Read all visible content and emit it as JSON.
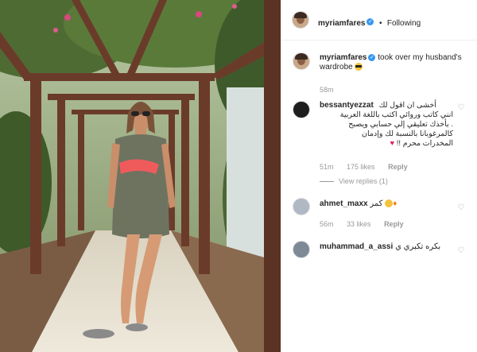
{
  "post": {
    "author": "myriamfares",
    "follow_status": "Following",
    "dot": "•"
  },
  "caption": {
    "username": "myriamfares",
    "text": "took over my husband's wardrobe",
    "emoji": "sunglasses-emoji",
    "time": "58m"
  },
  "comments": [
    {
      "username": "bessantyezzat",
      "lines": [
        "أخشى ان اقول لك",
        "انني كاتب وروائي اكتب باللغة العربية",
        ". بأخذك تعليقي إلي حسابي ويصبح",
        "كالمرغوبانا بالنسبة لك وإدمان",
        "المخدرات محرم !!"
      ],
      "emoji": "red-heart",
      "time": "51m",
      "likes": "175 likes",
      "reply": "Reply",
      "view_replies": "View replies (1)"
    },
    {
      "username": "ahmet_maxx",
      "text": "كمر",
      "emoji": "heart-eyes-fire",
      "time": "56m",
      "likes": "33 likes",
      "reply": "Reply"
    },
    {
      "username": "muhammad_a_assi",
      "text": "بكره تكبري ي"
    }
  ],
  "colors": {
    "verified": "#3897f0",
    "muted": "#999999",
    "text": "#262626"
  }
}
